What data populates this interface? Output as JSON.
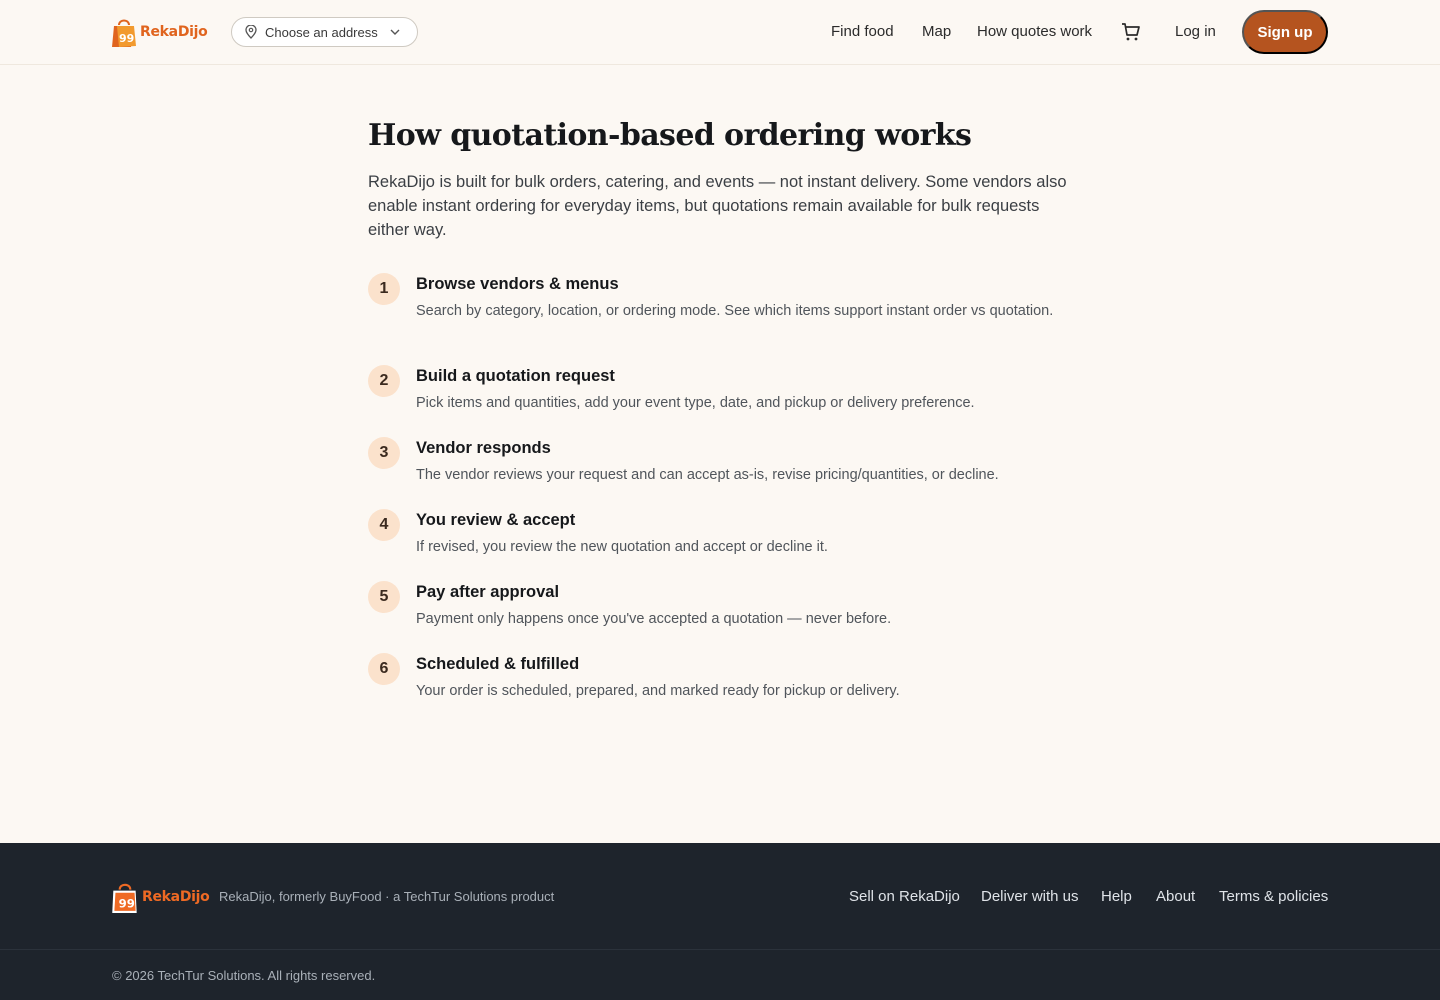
{
  "brand": {
    "name": "RekaDijo",
    "accent": "#b5541f",
    "logo_orange": "#e0641e"
  },
  "header": {
    "address_placeholder": "Choose an address",
    "nav": [
      "Find food",
      "Map",
      "How quotes work"
    ],
    "login": "Log in",
    "signup": "Sign up"
  },
  "main": {
    "title": "How quotation-based ordering works",
    "intro": "RekaDijo is built for bulk orders, catering, and events — not instant delivery. Some vendors also enable instant ordering for everyday items, but quotations remain available for bulk requests either way.",
    "steps": [
      {
        "num": "1",
        "title": "Browse vendors & menus",
        "desc": "Search by category, location, or ordering mode. See which items support instant order vs quotation."
      },
      {
        "num": "2",
        "title": "Build a quotation request",
        "desc": "Pick items and quantities, add your event type, date, and pickup or delivery preference."
      },
      {
        "num": "3",
        "title": "Vendor responds",
        "desc": "The vendor reviews your request and can accept as-is, revise pricing/quantities, or decline."
      },
      {
        "num": "4",
        "title": "You review & accept",
        "desc": "If revised, you review the new quotation and accept or decline it."
      },
      {
        "num": "5",
        "title": "Pay after approval",
        "desc": "Payment only happens once you've accepted a quotation — never before."
      },
      {
        "num": "6",
        "title": "Scheduled & fulfilled",
        "desc": "Your order is scheduled, prepared, and marked ready for pickup or delivery."
      }
    ]
  },
  "footer": {
    "tagline": "RekaDijo, formerly BuyFood · a TechTur Solutions product",
    "links": [
      "Sell on RekaDijo",
      "Deliver with us",
      "Help",
      "About",
      "Terms & policies"
    ],
    "copyright": "© 2026 TechTur Solutions. All rights reserved."
  },
  "icons": [
    "shopping-bag-logo-icon",
    "map-pin-icon",
    "chevron-down-icon",
    "cart-icon"
  ]
}
